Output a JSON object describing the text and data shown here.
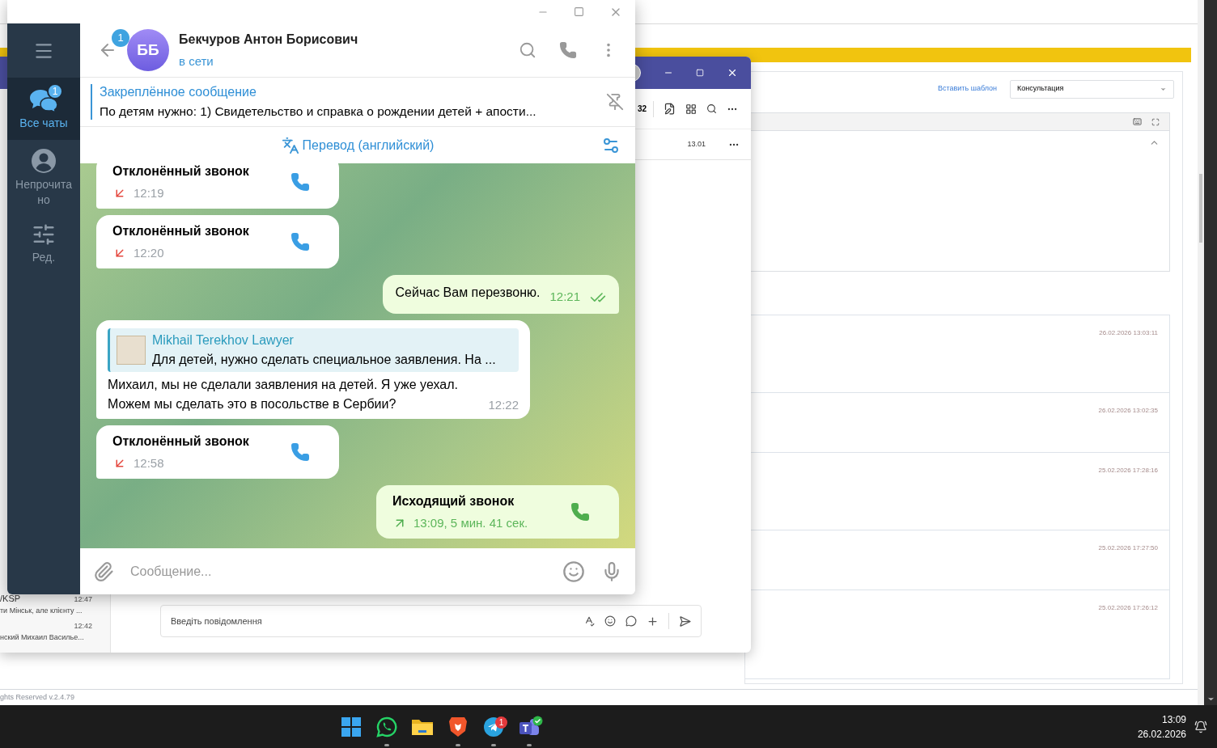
{
  "crm": {
    "insert_template_link": "Вставить шаблон",
    "template_select": "Консультация",
    "history": [
      {
        "timestamp": "26.02.2026 13:03:11"
      },
      {
        "timestamp": "26.02.2026 13:02:35"
      },
      {
        "timestamp": "25.02.2026 17:28:16"
      },
      {
        "timestamp": "25.02.2026 17:27:50"
      },
      {
        "timestamp": "25.02.2026 17:26:12"
      }
    ],
    "footer": "ghts Reserved v.2.4.79"
  },
  "teams_window": {
    "toolbar_count": "32",
    "row_time": "13.01",
    "chats": [
      {
        "name": "/KSP",
        "time": "12:47",
        "preview": "ти Мінськ, але клієнту ..."
      },
      {
        "time": "12:42",
        "preview": "нский Михаил Василье..."
      }
    ],
    "message_placeholder": "Введіть повідомлення"
  },
  "telegram": {
    "folders": [
      {
        "kind": "chats",
        "label": "Все чаты",
        "badge": "1",
        "selected": true
      },
      {
        "kind": "unread",
        "label": "Непрочитано",
        "selected": false
      },
      {
        "kind": "edit",
        "label": "Ред.",
        "selected": false
      }
    ],
    "back_badge": "1",
    "chat": {
      "avatar": "ББ",
      "name": "Бекчуров Антон Борисович",
      "status": "в сети"
    },
    "pinned": {
      "title": "Закреплённое сообщение",
      "text": "По детям нужно:  1) Свидетельство и справка о рождении детей + апости..."
    },
    "translate": "Перевод (английский)",
    "messages": [
      {
        "kind": "call",
        "outgoing": false,
        "title": "Отклонённый звонок",
        "time": "12:19"
      },
      {
        "kind": "call",
        "outgoing": false,
        "title": "Отклонённый звонок",
        "time": "12:20"
      },
      {
        "kind": "text",
        "outgoing": true,
        "text": "Сейчас Вам перезвоню.",
        "time": "12:21",
        "read": true
      },
      {
        "kind": "reply",
        "outgoing": false,
        "quote_author": "Mikhail Terekhov Lawyer",
        "quote_text": "Для детей, нужно сделать специальное заявления. На ...",
        "text": "Михаил, мы не сделали заявления на детей. Я уже уехал. Можем мы сделать это в посольстве в Сербии?",
        "time": "12:22"
      },
      {
        "kind": "call",
        "outgoing": false,
        "title": "Отклонённый звонок",
        "time": "12:58"
      },
      {
        "kind": "call",
        "outgoing": true,
        "title": "Исходящий звонок",
        "time": "13:09, 5 мин. 41 сек."
      }
    ],
    "composer_placeholder": "Сообщение..."
  },
  "taskbar": {
    "apps": [
      {
        "kind": "start",
        "running": false
      },
      {
        "kind": "whatsapp",
        "running": true
      },
      {
        "kind": "explorer",
        "running": false
      },
      {
        "kind": "brave",
        "running": true
      },
      {
        "kind": "telegram",
        "running": true,
        "badge": "1"
      },
      {
        "kind": "teams",
        "running": true
      }
    ],
    "time": "13:09",
    "date": "26.02.2026"
  }
}
